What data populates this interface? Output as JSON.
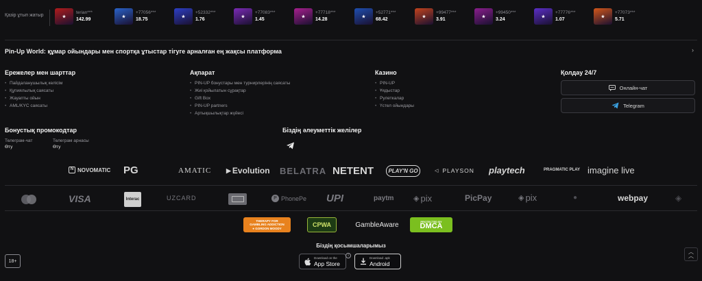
{
  "winners": {
    "label": "Қазір ұтып жатыр",
    "items": [
      {
        "user": "terian***",
        "amount": "142.99",
        "color": "#b11c1c"
      },
      {
        "user": "+77056***",
        "amount": "18.75",
        "color": "#2a63c9"
      },
      {
        "user": "+52332***",
        "amount": "1.76",
        "color": "#2d3fc4"
      },
      {
        "user": "+77083***",
        "amount": "1.45",
        "color": "#7a2bb5"
      },
      {
        "user": "+77718***",
        "amount": "14.28",
        "color": "#a7208e"
      },
      {
        "user": "+52771***",
        "amount": "68.42",
        "color": "#1f4fb0"
      },
      {
        "user": "+99477***",
        "amount": "3.91",
        "color": "#c2431d"
      },
      {
        "user": "+99450***",
        "amount": "3.24",
        "color": "#8a1e8c"
      },
      {
        "user": "+77776***",
        "amount": "1.07",
        "color": "#5b2fc7"
      },
      {
        "user": "+77073***",
        "amount": "5.71",
        "color": "#d2571a"
      }
    ]
  },
  "headline": "Pin-Up World: құмар ойындары мен спортқа ұтыстар тігуге арналған ең жақсы платформа",
  "rules": {
    "title": "Ережелер мен шарттар",
    "items": [
      "Пайдаланушылық келісім",
      "Құпиялылық саясаты",
      "Жауапты ойын",
      "AML/KYC саясаты"
    ]
  },
  "info": {
    "title": "Ақпарат",
    "items": [
      "PIN-UP бонустары мен турнирлерінің саясаты",
      "Жиі қойылатын сұрақтар",
      "Gift Box",
      "PIN-UP partners",
      "Артықшылықтар жүйесі"
    ]
  },
  "casino": {
    "title": "Казино",
    "items": [
      "PIN-UP",
      "Ұядыстар",
      "Рулеткалар",
      "Үстел ойындары"
    ]
  },
  "support": {
    "title": "Қолдау 24/7",
    "chat_label": "Онлайн-чат",
    "telegram_label": "Telegram"
  },
  "promo": {
    "title": "Бонустық промокодтар",
    "items": [
      {
        "label": "Телеграм-чат",
        "action": "Өту"
      },
      {
        "label": "Телеграм арнасы",
        "action": "Өту"
      }
    ]
  },
  "social": {
    "title": "Біздің әлеуметтік желілер"
  },
  "providers": [
    "NOVOMATIC",
    "PG",
    "AMATIC",
    "Evolution",
    "BELATRA",
    "NETENT",
    "PLAY'N GO",
    "PLAYSON",
    "playtech",
    "PRAGMATIC PLAY",
    "imagine live"
  ],
  "payments": [
    "VISA",
    "Interac",
    "UZCARD",
    "PhonePe",
    "UPI",
    "paytm",
    "pix",
    "PicPay",
    "pix",
    "webpay"
  ],
  "responsible": {
    "therapy_lines": [
      "THERAPY FOR",
      "GAMBLING ADDICTION",
      "● GORDON MOODY"
    ],
    "cpwa": "CPWA",
    "gambleaware": "GambleAware",
    "dmca_top": "PROTECTED BY",
    "dmca": "DMCA"
  },
  "apps": {
    "title": "Біздің қосымшаларымыз",
    "appstore_small": "Download on the",
    "appstore_big": "App Store",
    "android_small": "Download .apk",
    "android_big": "Android"
  },
  "age_badge": "18+"
}
